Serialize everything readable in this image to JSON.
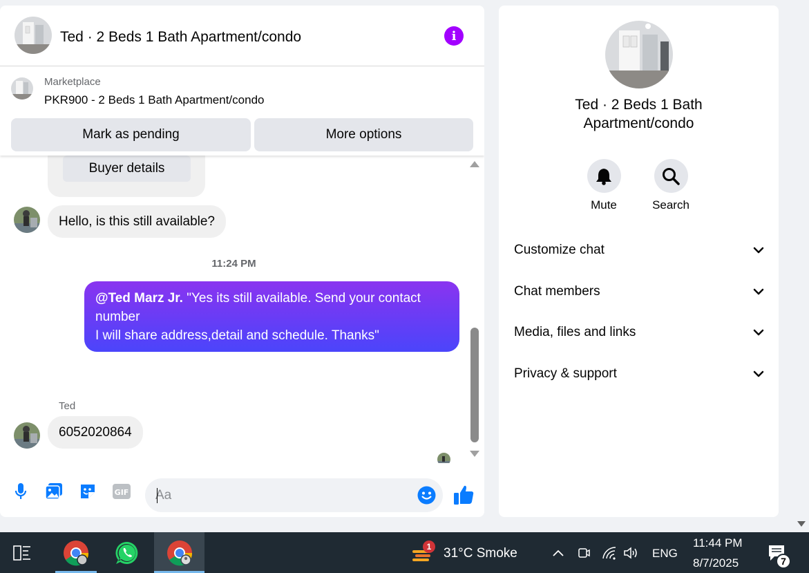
{
  "chat": {
    "title": "Ted · 2 Beds 1 Bath Apartment/condo",
    "marketplace_label": "Marketplace",
    "listing_name": "PKR900 - 2 Beds 1 Bath Apartment/condo",
    "mark_pending_label": "Mark as pending",
    "more_options_label": "More options",
    "buyer_details_label": "Buyer details"
  },
  "messages": {
    "incoming_1": "Hello, is this still available?",
    "timestamp": "11:24 PM",
    "outgoing_mention": "@Ted Marz Jr.",
    "outgoing_line1": "  \"Yes its still available. Send your contact number",
    "outgoing_line2": "I will share address,detail and schedule. Thanks\"",
    "sender_name": "Ted",
    "incoming_2": "6052020864"
  },
  "composer": {
    "placeholder": "Aa"
  },
  "info_panel": {
    "name": "Ted · 2 Beds 1 Bath Apartment/condo",
    "mute_label": "Mute",
    "search_label": "Search",
    "sections": [
      "Customize chat",
      "Chat members",
      "Media, files and links",
      "Privacy & support"
    ]
  },
  "taskbar": {
    "weather_badge": "1",
    "weather": "31°C  Smoke",
    "language": "ENG",
    "time": "11:44 PM",
    "date": "8/7/2025",
    "notification_count": "7"
  },
  "colors": {
    "accent_purple": "#a200ff",
    "outgoing_gradient_start": "#8a34f0",
    "outgoing_gradient_end": "#4b45fb",
    "messenger_blue": "#0a7cff",
    "taskbar_bg": "#1f2a33"
  }
}
